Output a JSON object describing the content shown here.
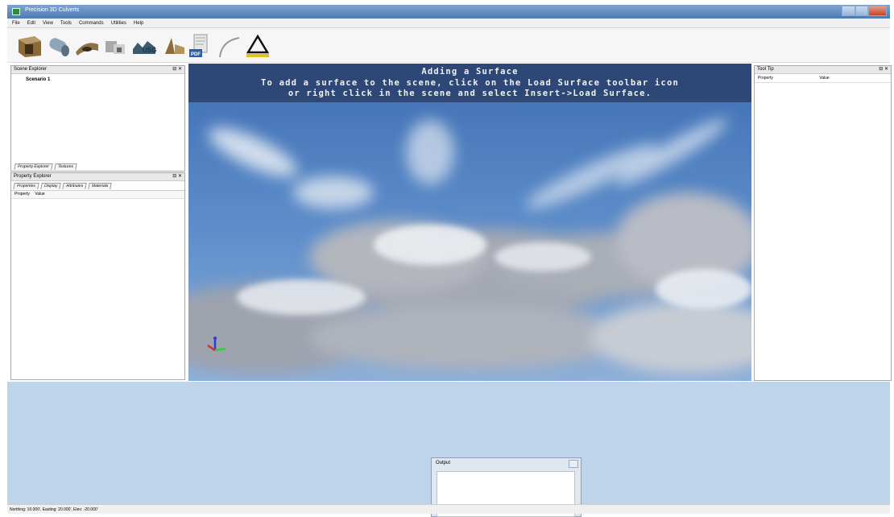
{
  "window": {
    "title": "Precision 3D Culverts",
    "icon": "app-logo-icon"
  },
  "menu": [
    "File",
    "Edit",
    "View",
    "Tools",
    "Commands",
    "Utilities",
    "Help"
  ],
  "toolbar": {
    "icons": [
      "box-culvert-icon",
      "pipe-culvert-icon",
      "arch-culvert-icon",
      "headwall-icon",
      "usgs-icon",
      "wingwall-icon",
      "pdf-report-icon",
      "curve-icon",
      "load-surface-icon"
    ]
  },
  "scene_explorer": {
    "title": "Scene Explorer",
    "items": [
      "Scenario 1"
    ],
    "tabs": [
      "Property Explorer",
      "Textures"
    ]
  },
  "property_explorer": {
    "title": "Property Explorer",
    "tabs": [
      "Properties",
      "Display",
      "Attributes",
      "Materials"
    ],
    "columns": [
      "Property",
      "Value"
    ]
  },
  "tooltip_panel": {
    "title": "Tool Tip",
    "columns": [
      "Property",
      "Value"
    ]
  },
  "viewport": {
    "banner_title": "Adding a Surface",
    "banner_line1": "To add a surface to the scene, click on the Load Surface toolbar icon",
    "banner_line2": "or right click in the scene and select Insert->Load Surface."
  },
  "output": {
    "title": "Output"
  },
  "status": {
    "text": "Northing: 10.000', Easting: 20.000', Elev: -20.000'"
  }
}
